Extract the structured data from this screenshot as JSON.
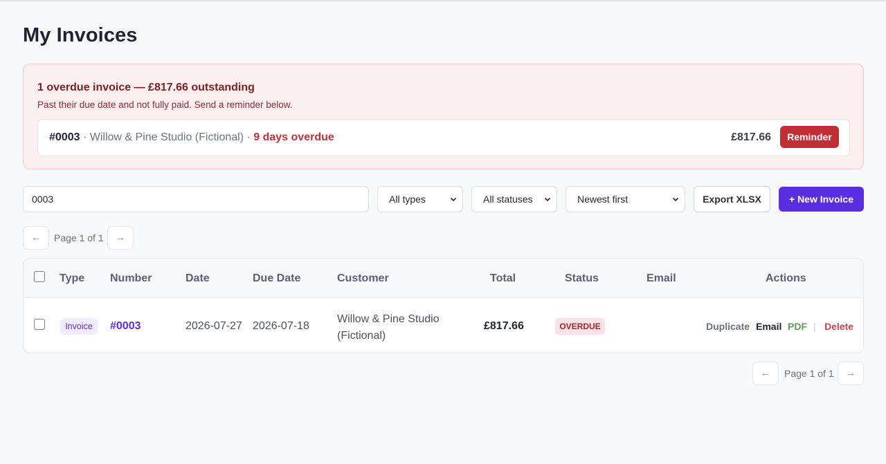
{
  "page": {
    "title": "My Invoices"
  },
  "alert": {
    "title": "1 overdue invoice — £817.66 outstanding",
    "subtitle": "Past their due date and not fully paid. Send a reminder below.",
    "item": {
      "number": "#0003",
      "customer": "Willow & Pine Studio (Fictional)",
      "overdue": "9 days overdue",
      "amount": "£817.66",
      "reminder_label": "Reminder"
    }
  },
  "toolbar": {
    "search_value": "0003",
    "type_filter": "All types",
    "status_filter": "All statuses",
    "sort": "Newest first",
    "export_label": "Export XLSX",
    "new_label": "+ New Invoice"
  },
  "pagination": {
    "prev": "←",
    "next": "→",
    "label": "Page 1 of 1"
  },
  "table": {
    "columns": [
      "Type",
      "Number",
      "Date",
      "Due Date",
      "Customer",
      "Total",
      "Status",
      "Email",
      "Actions"
    ],
    "rows": [
      {
        "type": "Invoice",
        "number": "#0003",
        "date": "2026-07-27",
        "due_date": "2026-07-18",
        "customer": "Willow & Pine Studio (Fictional)",
        "total": "£817.66",
        "status": "OVERDUE",
        "email": "",
        "actions": {
          "duplicate": "Duplicate",
          "email": "Email",
          "pdf": "PDF",
          "separator": "|",
          "delete": "Delete"
        }
      }
    ]
  },
  "colors": {
    "accent": "#5a2ee0",
    "danger": "#c02f36",
    "alert_bg": "#fbeff0"
  }
}
